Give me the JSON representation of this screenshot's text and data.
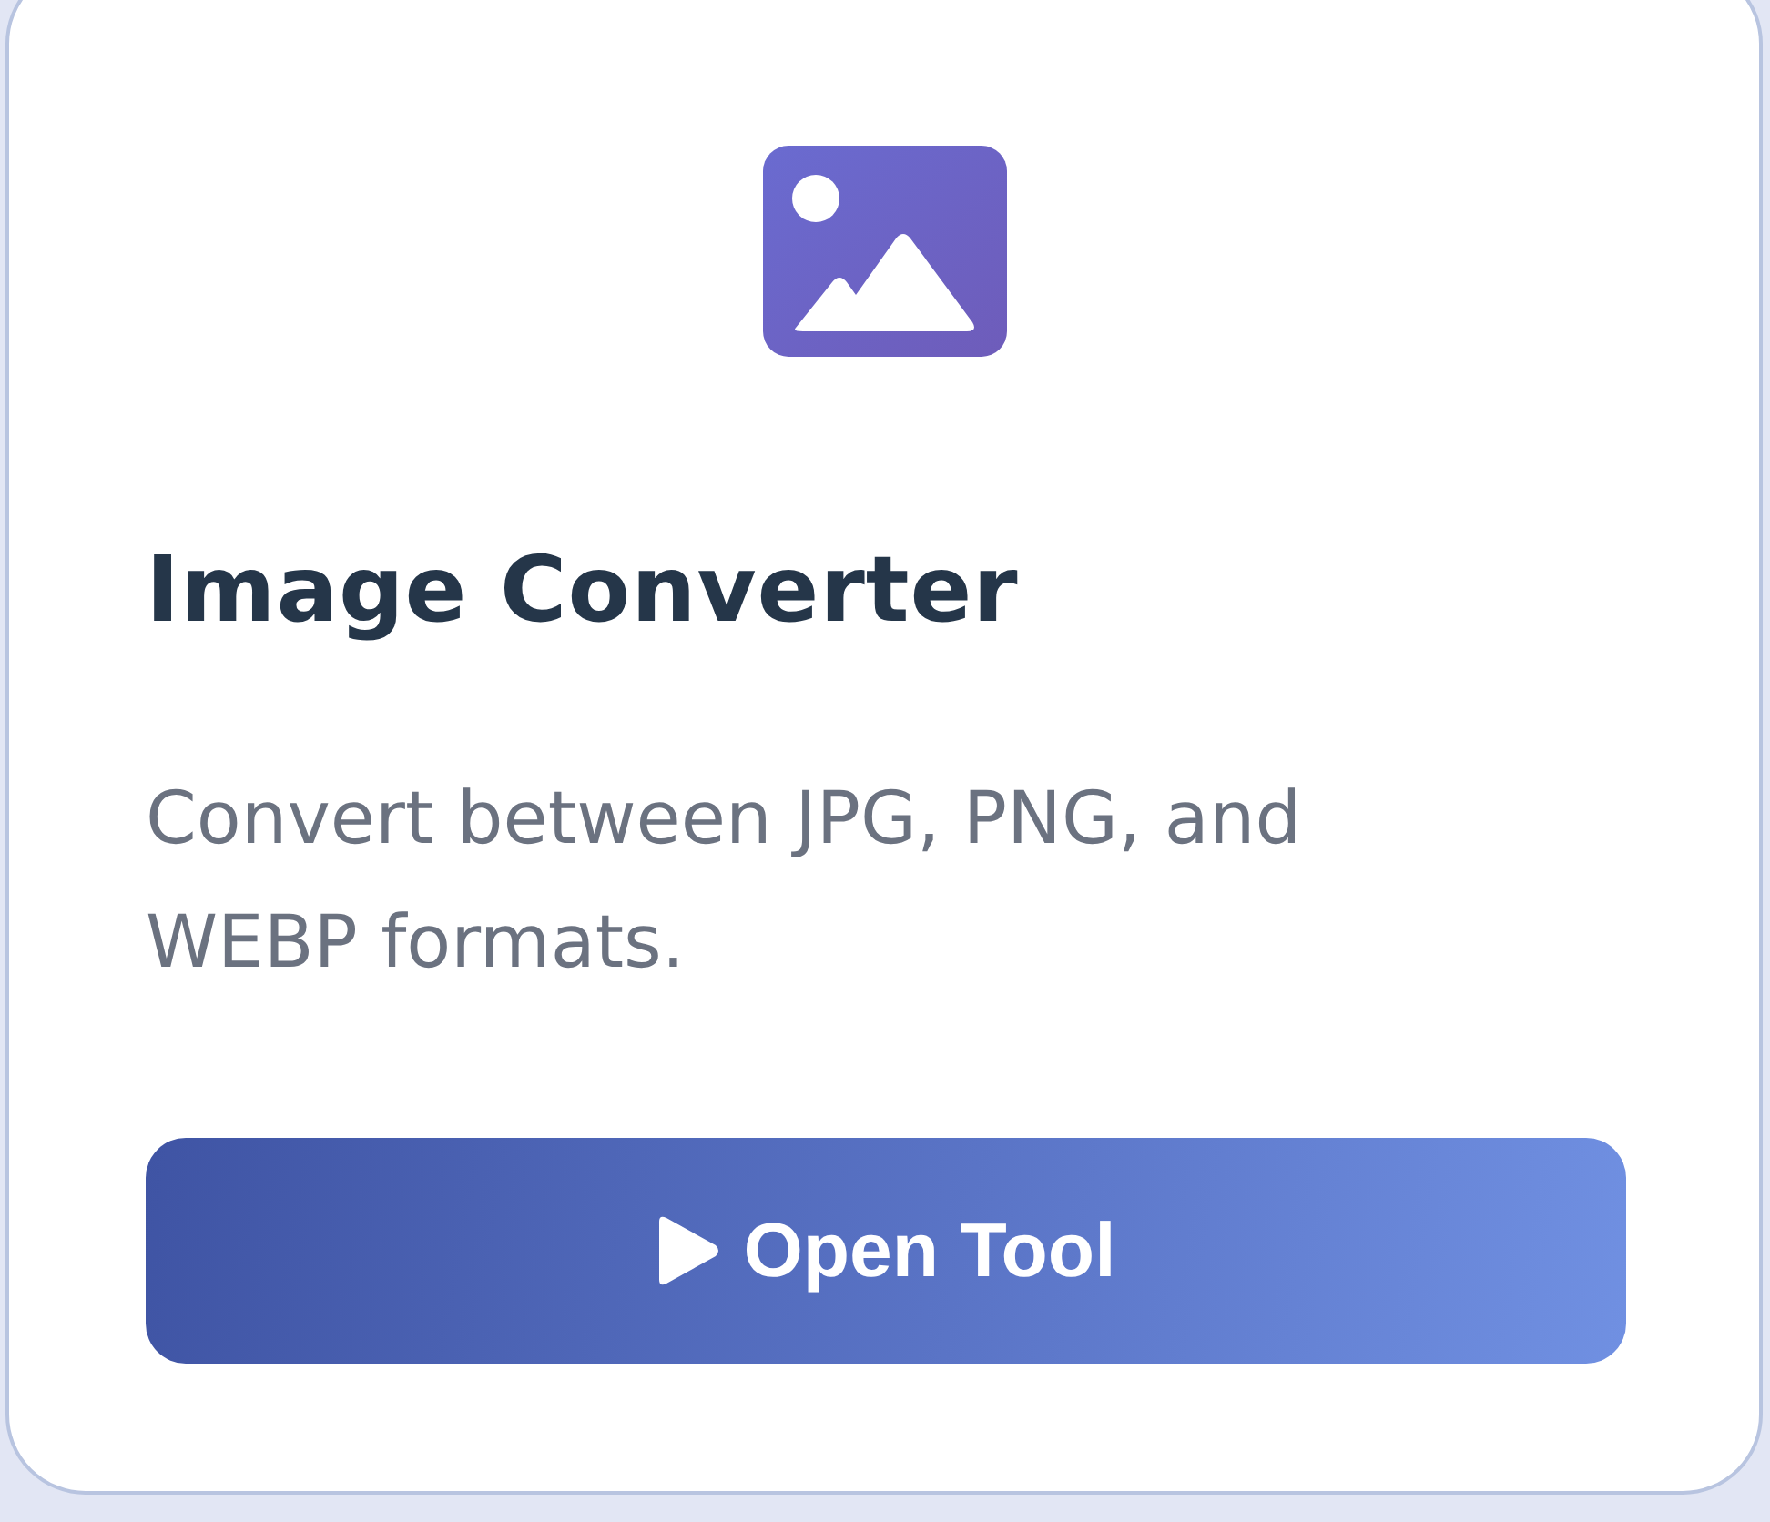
{
  "card": {
    "title": "Image Converter",
    "description": "Convert between JPG, PNG, and WEBP formats.",
    "button": {
      "label": "Open Tool"
    }
  }
}
